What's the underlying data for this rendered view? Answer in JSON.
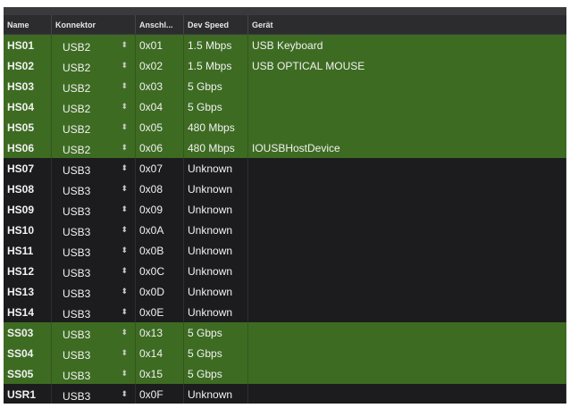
{
  "columns": {
    "name": "Name",
    "connector": "Konnektor",
    "port": "Anschl...",
    "speed": "Dev Speed",
    "device": "Gerät"
  },
  "icons": {
    "connector_stepper": "up-down-chevron-icon"
  },
  "colors": {
    "active_row": "#3d6b22",
    "inactive_row": "#1c1c1e"
  },
  "rows": [
    {
      "name": "HS01",
      "connector": "USB2",
      "port": "0x01",
      "speed": "1.5 Mbps",
      "device": "USB Keyboard",
      "active": true
    },
    {
      "name": "HS02",
      "connector": "USB2",
      "port": "0x02",
      "speed": "1.5 Mbps",
      "device": "USB OPTICAL MOUSE",
      "active": true
    },
    {
      "name": "HS03",
      "connector": "USB2",
      "port": "0x03",
      "speed": "5 Gbps",
      "device": "",
      "active": true
    },
    {
      "name": "HS04",
      "connector": "USB2",
      "port": "0x04",
      "speed": "5 Gbps",
      "device": "",
      "active": true
    },
    {
      "name": "HS05",
      "connector": "USB2",
      "port": "0x05",
      "speed": "480 Mbps",
      "device": "",
      "active": true
    },
    {
      "name": "HS06",
      "connector": "USB2",
      "port": "0x06",
      "speed": "480 Mbps",
      "device": "IOUSBHostDevice",
      "active": true
    },
    {
      "name": "HS07",
      "connector": "USB3",
      "port": "0x07",
      "speed": "Unknown",
      "device": "",
      "active": false
    },
    {
      "name": "HS08",
      "connector": "USB3",
      "port": "0x08",
      "speed": "Unknown",
      "device": "",
      "active": false
    },
    {
      "name": "HS09",
      "connector": "USB3",
      "port": "0x09",
      "speed": "Unknown",
      "device": "",
      "active": false
    },
    {
      "name": "HS10",
      "connector": "USB3",
      "port": "0x0A",
      "speed": "Unknown",
      "device": "",
      "active": false
    },
    {
      "name": "HS11",
      "connector": "USB3",
      "port": "0x0B",
      "speed": "Unknown",
      "device": "",
      "active": false
    },
    {
      "name": "HS12",
      "connector": "USB3",
      "port": "0x0C",
      "speed": "Unknown",
      "device": "",
      "active": false
    },
    {
      "name": "HS13",
      "connector": "USB3",
      "port": "0x0D",
      "speed": "Unknown",
      "device": "",
      "active": false
    },
    {
      "name": "HS14",
      "connector": "USB3",
      "port": "0x0E",
      "speed": "Unknown",
      "device": "",
      "active": false
    },
    {
      "name": "SS03",
      "connector": "USB3",
      "port": "0x13",
      "speed": "5 Gbps",
      "device": "",
      "active": true
    },
    {
      "name": "SS04",
      "connector": "USB3",
      "port": "0x14",
      "speed": "5 Gbps",
      "device": "",
      "active": true
    },
    {
      "name": "SS05",
      "connector": "USB3",
      "port": "0x15",
      "speed": "5 Gbps",
      "device": "",
      "active": true
    },
    {
      "name": "USR1",
      "connector": "USB3",
      "port": "0x0F",
      "speed": "Unknown",
      "device": "",
      "active": false
    }
  ]
}
